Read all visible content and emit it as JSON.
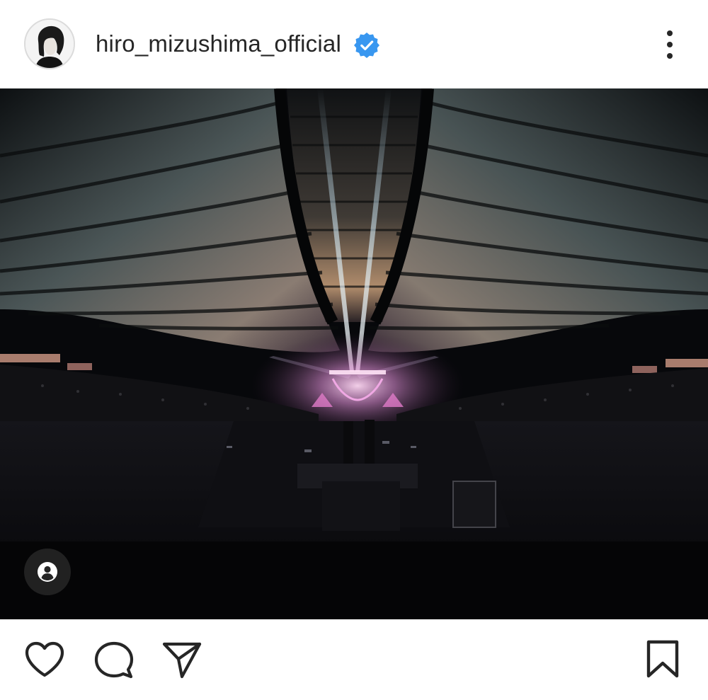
{
  "post": {
    "username": "hiro_mizushima_official",
    "verified": true,
    "avatar_icon": "profile-photo",
    "more_icon": "more-vertical-icon"
  },
  "photo": {
    "subject": "concert-arena-interior",
    "tag_icon": "user-tag-icon"
  },
  "actions": {
    "like_icon": "heart-icon",
    "comment_icon": "comment-icon",
    "share_icon": "send-icon",
    "save_icon": "bookmark-icon"
  },
  "colors": {
    "text": "#262626",
    "verified_blue": "#3897f0",
    "background": "#ffffff"
  }
}
